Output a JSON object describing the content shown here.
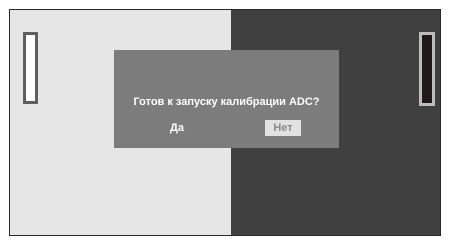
{
  "dialog": {
    "prompt": "Готов к запуску калибрации ADC?",
    "yes_label": "Да",
    "no_label": "Нет",
    "selected": "Нет"
  },
  "colors": {
    "left_panel": "#e6e6e6",
    "right_panel": "#404040",
    "dialog_bg": "#7c7c7c",
    "selected_button_bg": "#e2e2e2"
  }
}
